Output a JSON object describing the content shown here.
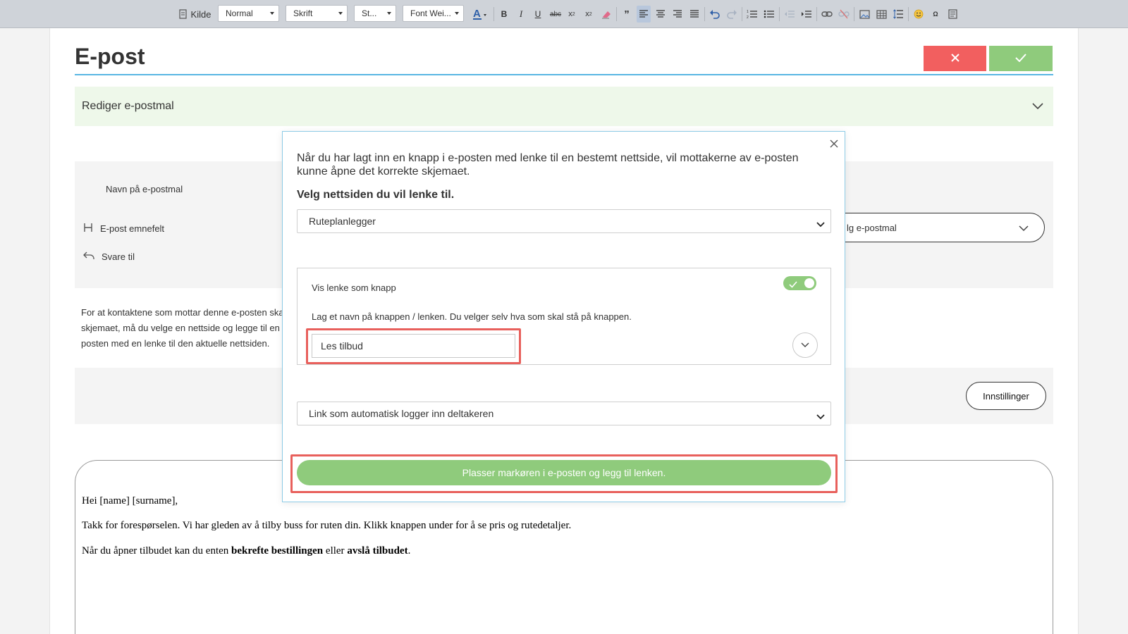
{
  "toolbar": {
    "source_label": "Kilde",
    "format_combo": "Normal",
    "font_combo": "Skrift",
    "size_combo": "St...",
    "weight_combo": "Font Wei...",
    "icons": [
      "source-icon",
      "text-color-icon",
      "bold-icon",
      "italic-icon",
      "underline-icon",
      "strikethrough-icon",
      "subscript-icon",
      "superscript-icon",
      "remove-format-icon",
      "blockquote-icon",
      "align-left-icon",
      "align-center-icon",
      "align-right-icon",
      "justify-icon",
      "undo-icon",
      "redo-icon",
      "numbered-list-icon",
      "bulleted-list-icon",
      "outdent-icon",
      "indent-icon",
      "link-icon",
      "unlink-icon",
      "image-icon",
      "table-icon",
      "line-spacing-icon",
      "emoji-icon",
      "special-char-icon",
      "preview-icon"
    ]
  },
  "page": {
    "title": "E-post",
    "accent_color": "#58b6e3",
    "cancel_color": "#f25f5f",
    "ok_color": "#8fcb7c"
  },
  "accordion": {
    "title": "Rediger e-postmal"
  },
  "settings": {
    "name_label": "Navn på e-postmal",
    "subject_label": "E-post emnefelt",
    "reply_label": "Svare til",
    "template_select": "lg e-postmal"
  },
  "info": {
    "line1": "For at kontaktene som mottar denne e-posten ska",
    "line2": "skjemaet, må du velge en nettside og legge til en",
    "line3": "posten med en lenke til den aktuelle nettsiden."
  },
  "actions": {
    "settings_button": "Innstillinger"
  },
  "email": {
    "greeting": "Hei [name] [surname],",
    "line1": "Takk for forespørselen. Vi har gleden av å tilby buss for ruten din. Klikk knappen under for å se pris og rutedetaljer.",
    "line2_pre": "Når du åpner tilbudet kan du enten ",
    "line2_bold1": "bekrefte bestillingen",
    "line2_mid": " eller ",
    "line2_bold2": "avslå tilbudet",
    "line2_post": "."
  },
  "modal": {
    "intro": "Når du har lagt inn en knapp i e-posten med lenke til en bestemt nettside, vil mottakerne av e-posten kunne åpne det korrekte skjemaet.",
    "heading": "Velg nettsiden du vil lenke til.",
    "page_select": "Ruteplanlegger",
    "toggle_label": "Vis lenke som knapp",
    "toggle_on": true,
    "name_hint": "Lag et navn på knappen / lenken. Du velger selv hva som skal stå på knappen.",
    "button_name_value": "Les tilbud",
    "link_type_select": "Link som automatisk logger inn deltakeren",
    "place_button": "Plasser markøren i e-posten og legg til lenken.",
    "highlight_color": "#e8605c"
  }
}
